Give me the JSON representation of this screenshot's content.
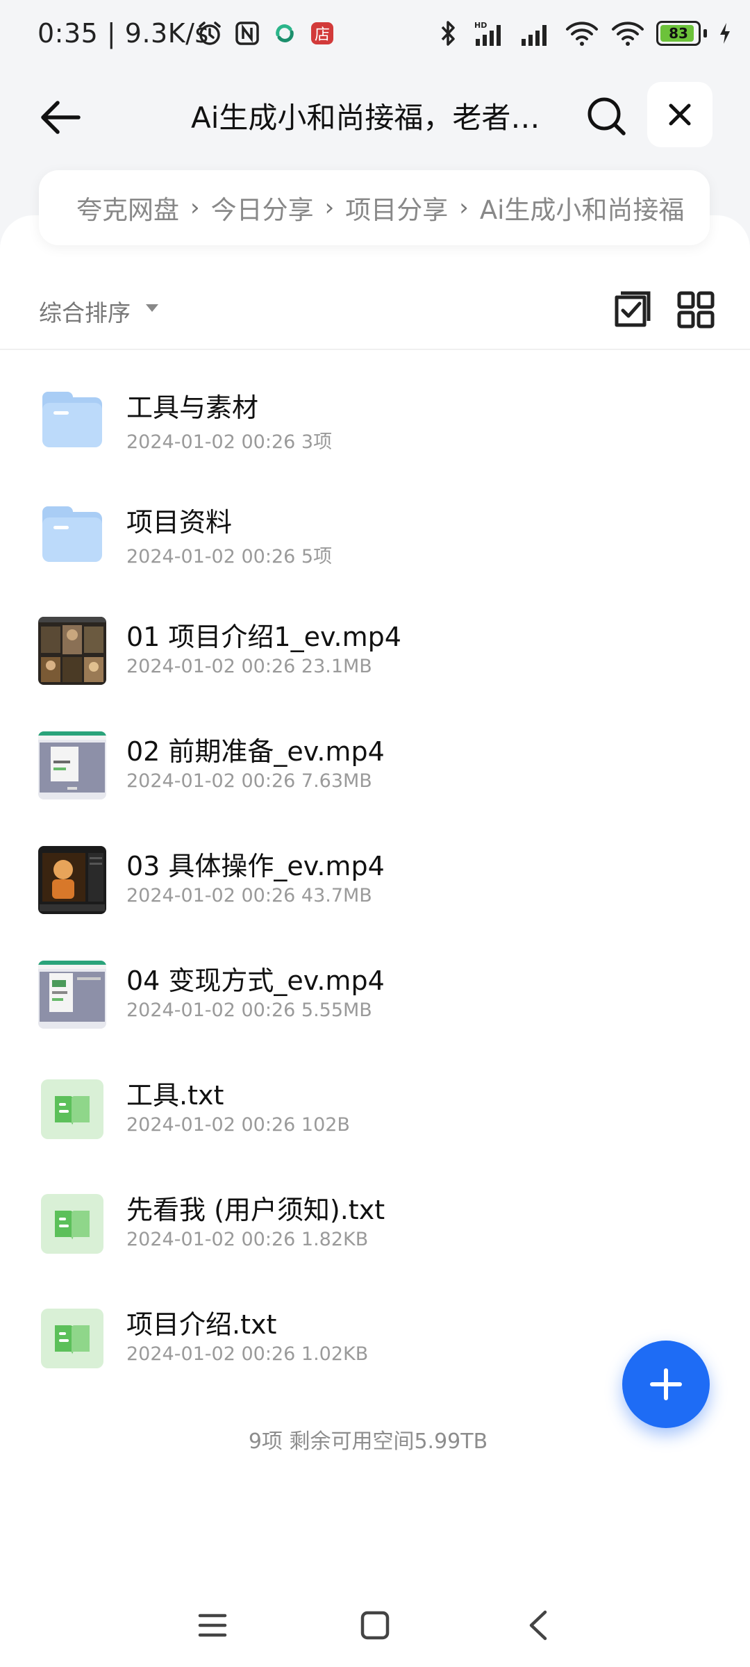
{
  "status_bar": {
    "time_speed": "0:35 | 9.3K/s",
    "battery": "83",
    "icons": [
      "alarm-icon",
      "nfc-icon",
      "app-notification-icon",
      "shop-notification-icon",
      "bluetooth-icon",
      "signal-hd-icon",
      "signal-icon",
      "wifi-icon",
      "wifi-icon",
      "battery-icon",
      "charging-icon"
    ]
  },
  "header": {
    "title": "Ai生成小和尚接福，老者…",
    "back_icon": "arrow-left-icon",
    "search_icon": "search-icon",
    "close_icon": "close-icon"
  },
  "breadcrumb": {
    "items": [
      "夸克网盘",
      "今日分享",
      "项目分享",
      "Ai生成小和尚接福"
    ],
    "separator": "›"
  },
  "toolbar": {
    "sort_label": "综合排序",
    "multiselect_icon": "checklist-icon",
    "grid_icon": "grid-view-icon"
  },
  "files": [
    {
      "name": "工具与素材",
      "meta": "2024-01-02 00:26  3项",
      "type": "folder"
    },
    {
      "name": "项目资料",
      "meta": "2024-01-02 00:26  5项",
      "type": "folder"
    },
    {
      "name": "01 项目介绍1_ev.mp4",
      "meta": "2024-01-02 00:26  23.1MB",
      "type": "video"
    },
    {
      "name": "02 前期准备_ev.mp4",
      "meta": "2024-01-02 00:26  7.63MB",
      "type": "video"
    },
    {
      "name": "03 具体操作_ev.mp4",
      "meta": "2024-01-02 00:26  43.7MB",
      "type": "video"
    },
    {
      "name": "04 变现方式_ev.mp4",
      "meta": "2024-01-02 00:26  5.55MB",
      "type": "video"
    },
    {
      "name": "工具.txt",
      "meta": "2024-01-02 00:26  102B",
      "type": "txt"
    },
    {
      "name": "先看我 (用户须知).txt",
      "meta": "2024-01-02 00:26  1.82KB",
      "type": "txt"
    },
    {
      "name": "项目介绍.txt",
      "meta": "2024-01-02 00:26  1.02KB",
      "type": "txt"
    }
  ],
  "footer": {
    "summary": "9项 剩余可用空间5.99TB"
  },
  "fab_icon": "plus-icon",
  "colors": {
    "accent": "#1e6cf5",
    "folder": "#bcdafa",
    "txt_bg": "#d9f0d6",
    "txt_icon": "#5cc05a"
  }
}
